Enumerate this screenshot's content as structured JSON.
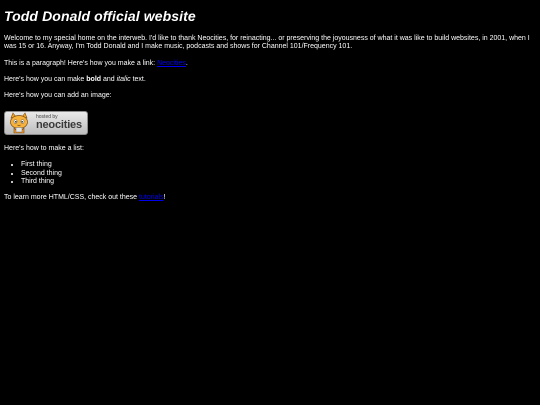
{
  "title": "Todd Donald official website",
  "intro": "Welcome to my special home on the interweb. I'd like to thank Neocities, for reinacting... or preserving the joyousness of what it was like to build websites, in 2001, when I was 15 or 16. Anyway, I'm Todd Donald and I make music, podcasts and shows for Channel 101/Frequency 101.",
  "link_paragraph": {
    "prefix": "This is a paragraph! Here's how you make a link: ",
    "link_text": "Neocities",
    "suffix": "."
  },
  "format_paragraph": {
    "prefix": "Here's how you can make ",
    "bold": "bold",
    "middle": " and ",
    "italic": "italic",
    "suffix": " text."
  },
  "image_paragraph": "Here's how you can add an image:",
  "badge": {
    "small_text": "hosted by",
    "big_text": "neocities"
  },
  "list_paragraph": "Here's how to make a list:",
  "list_items": [
    "First thing",
    "Second thing",
    "Third thing"
  ],
  "learn_paragraph": {
    "prefix": "To learn more HTML/CSS, check out these ",
    "link_text": "tutorials",
    "suffix": "!"
  },
  "colors": {
    "background": "#000000",
    "text": "#ffffff",
    "link": "#0000ee"
  }
}
